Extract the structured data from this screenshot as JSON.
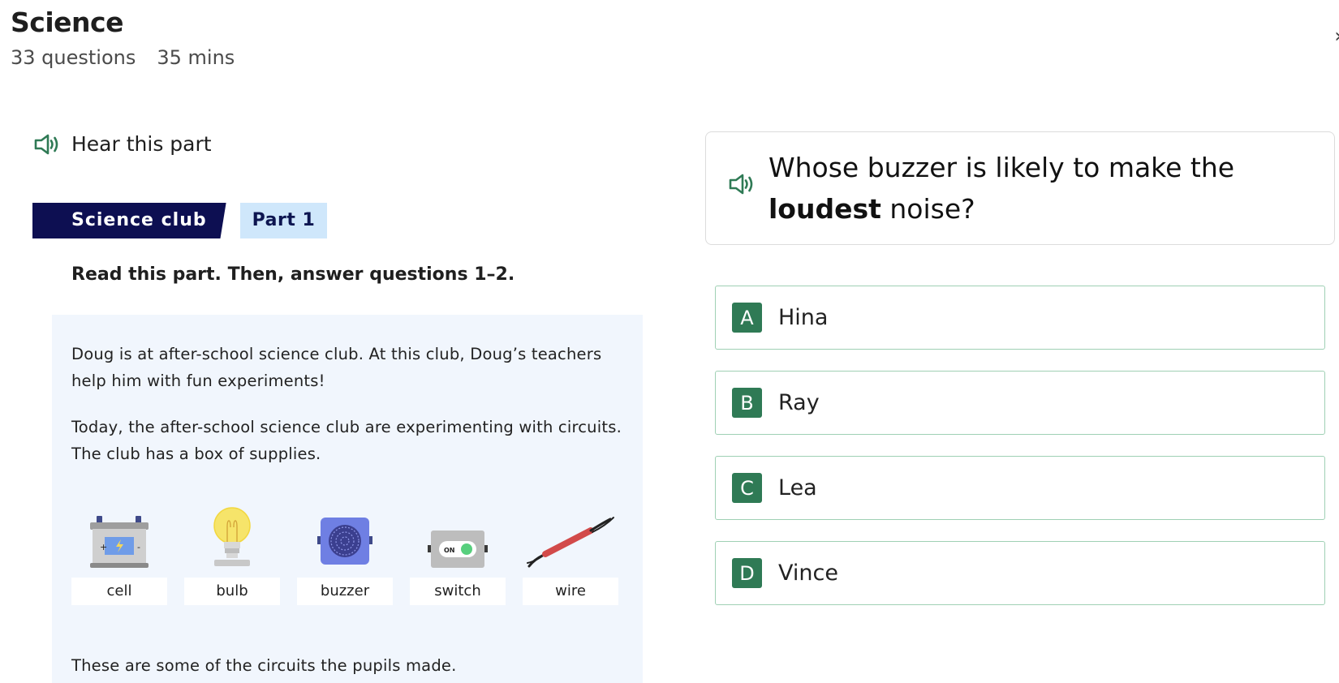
{
  "header": {
    "title": "Science",
    "question_count": "33 questions",
    "duration": "35 mins",
    "corner_glyph": "›"
  },
  "passage": {
    "hear_label": "Hear this part",
    "tag_topic": "Science club",
    "tag_part": "Part 1",
    "instruction": "Read this part. Then, answer questions 1–2.",
    "paragraphs": [
      "Doug is at after-school science club. At this club, Doug’s teachers help him with fun experiments!",
      "Today, the after-school science club are experimenting with circuits. The club has a box of supplies."
    ],
    "supplies": [
      {
        "label": "cell",
        "icon": "cell-icon"
      },
      {
        "label": "bulb",
        "icon": "bulb-icon"
      },
      {
        "label": "buzzer",
        "icon": "buzzer-icon"
      },
      {
        "label": "switch",
        "icon": "switch-icon"
      },
      {
        "label": "wire",
        "icon": "wire-icon"
      }
    ],
    "switch_text": "ON",
    "closing": "These are some of the circuits the pupils made."
  },
  "question": {
    "text_before": "Whose buzzer is likely to make the ",
    "text_bold": "loudest",
    "text_after": " noise?",
    "options": [
      {
        "letter": "A",
        "label": "Hina"
      },
      {
        "letter": "B",
        "label": "Ray"
      },
      {
        "letter": "C",
        "label": "Lea"
      },
      {
        "letter": "D",
        "label": "Vince"
      }
    ]
  },
  "colors": {
    "accent_green": "#2f7a55",
    "option_border": "#9fd0b4",
    "topic_tag_bg": "#0d0f52",
    "part_tag_bg": "#cfe7fb",
    "passage_bg": "#f1f6fd"
  }
}
